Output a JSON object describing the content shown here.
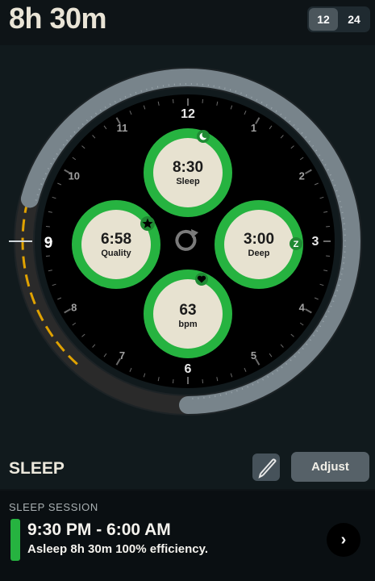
{
  "header": {
    "total_duration": "8h 30m",
    "clock_format_options": [
      "12",
      "24"
    ],
    "selected_format": "12"
  },
  "clock": {
    "hour_labels": [
      "12",
      "1",
      "2",
      "3",
      "4",
      "5",
      "6",
      "7",
      "8",
      "9",
      "10",
      "11"
    ],
    "highlighted_hour": "9",
    "sleep_arc": {
      "start": "9:30 PM",
      "end": "6:00 AM"
    },
    "colors": {
      "sleep_ring": "#78848b",
      "awake_arc": "#2a2a2a",
      "awake_dash": "#e0a200",
      "metric_ring": "#26b340",
      "metric_fill": "#e7e2d0",
      "face": "#000000"
    },
    "metrics": [
      {
        "id": "sleep",
        "value": "8:30",
        "label": "Sleep",
        "icon": "moon-icon"
      },
      {
        "id": "quality",
        "value": "6:58",
        "label": "Quality",
        "icon": "star-icon"
      },
      {
        "id": "deep",
        "value": "3:00",
        "label": "Deep",
        "icon": "z-icon"
      },
      {
        "id": "heart",
        "value": "63",
        "label": "bpm",
        "icon": "heart-icon"
      }
    ],
    "center_icon": "refresh-icon"
  },
  "section": {
    "title": "SLEEP",
    "edit_icon": "pencil-icon",
    "adjust_label": "Adjust"
  },
  "session": {
    "label": "SLEEP SESSION",
    "time_range": "9:30 PM - 6:00 AM",
    "detail": "Asleep 8h 30m 100% efficiency.",
    "accent": "#26b340",
    "chevron": "›"
  }
}
